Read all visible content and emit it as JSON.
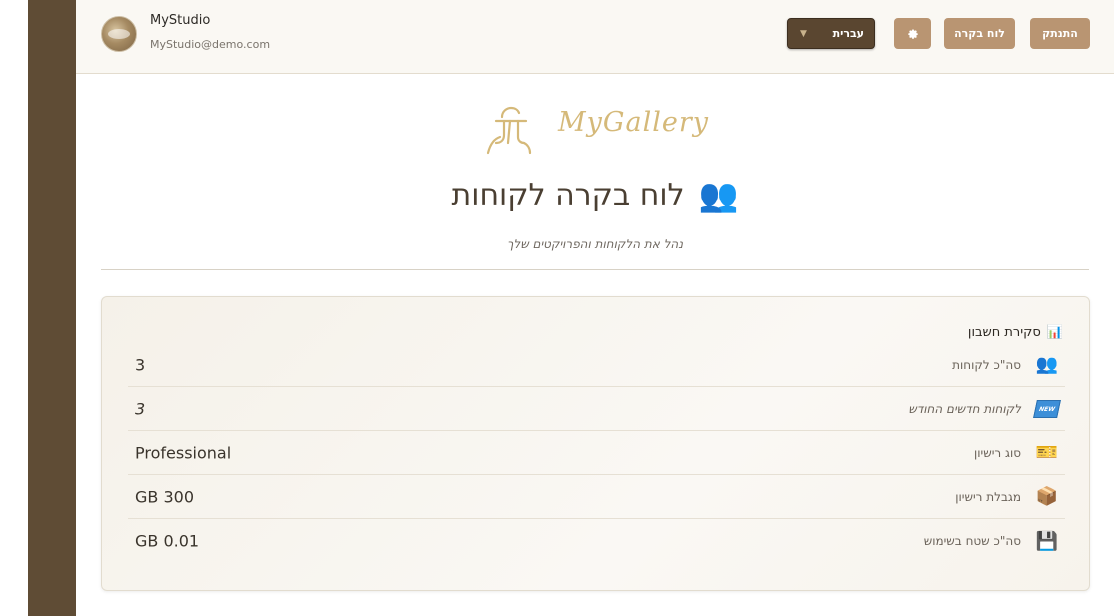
{
  "user": {
    "name": "MyStudio",
    "email": "MyStudio@demo.com"
  },
  "topbar": {
    "language_value": "עברית",
    "language_caret": "▼",
    "settings_icon": "gear-icon",
    "dashboard_label": "לוח בקרה",
    "logout_label": "התנתק"
  },
  "logo": {
    "text": "MyGallery",
    "icon": "logo-photographer-icon"
  },
  "page": {
    "title": "לוח בקרה לקוחות",
    "title_icon": "👥",
    "subtitle": "נהל את הלקוחות והפרויקטים שלך"
  },
  "overview": {
    "title": "סקירת חשבון",
    "title_icon": "📊",
    "rows": [
      {
        "label": "סה\"כ לקוחות",
        "value": "3",
        "icon": "👥"
      },
      {
        "label": "לקוחות חדשים החודש",
        "value": "3",
        "icon": "NEW"
      },
      {
        "label": "סוג רישיון",
        "value": "Professional",
        "icon": "🎫"
      },
      {
        "label": "מגבלת רישיון",
        "value": "GB 300",
        "icon": "📦"
      },
      {
        "label": "סה\"כ שטח בשימוש",
        "value": "GB 0.01",
        "icon": "💾"
      }
    ]
  },
  "colors": {
    "sidebar": "#5f4c35",
    "accent_button": "#b99572",
    "language_button": "#5a4630",
    "logo_gold": "#d5b979"
  }
}
